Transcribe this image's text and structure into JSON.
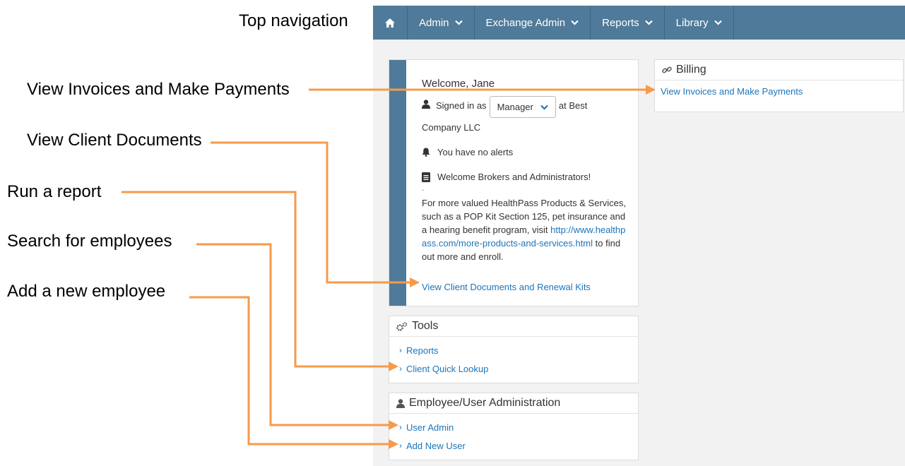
{
  "callouts": {
    "top_nav": "Top navigation",
    "invoices": "View Invoices and Make Payments",
    "client_docs": "View Client Documents",
    "run_report": "Run a report",
    "search_employees": "Search for employees",
    "add_employee": "Add a new employee"
  },
  "nav": {
    "items": [
      {
        "label": "Admin"
      },
      {
        "label": "Exchange Admin"
      },
      {
        "label": "Reports"
      },
      {
        "label": "Library"
      }
    ]
  },
  "welcome": {
    "title": "Welcome, Jane",
    "signed_in_prefix": "Signed in as",
    "role": "Manager",
    "signed_in_suffix": "at Best",
    "company": "Company LLC",
    "alerts": "You have no alerts",
    "message_title": "Welcome Brokers and Administrators!",
    "dot": "·",
    "para_text": "For more valued HealthPass Products & Services, such as a POP Kit Section 125, pet insurance and a hearing benefit program, visit",
    "para_link": "http://www.healthpass.com/more-products-and-services.html",
    "para_suffix": "to find out more and enroll.",
    "client_docs_link": "View Client Documents and Renewal Kits"
  },
  "tools": {
    "title": "Tools",
    "items": [
      {
        "label": "Reports"
      },
      {
        "label": "Client Quick Lookup"
      }
    ]
  },
  "employee_admin": {
    "title": "Employee/User Administration",
    "items": [
      {
        "label": "User Admin"
      },
      {
        "label": "Add New User"
      }
    ]
  },
  "billing": {
    "title": "Billing",
    "link": "View Invoices and Make Payments"
  },
  "colors": {
    "nav_bg": "#4f7a99",
    "link": "#1b75bb",
    "arrow": "#f79a4a",
    "page_bg": "#f2f2f2"
  },
  "icons": [
    "home-icon",
    "chevron-down-icon",
    "user-icon",
    "bell-icon",
    "document-icon",
    "gears-icon",
    "link-icon"
  ]
}
